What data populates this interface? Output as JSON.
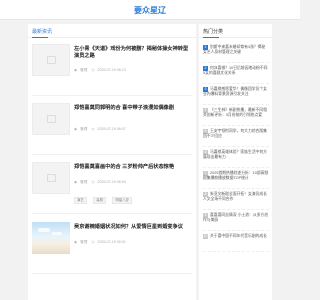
{
  "header": {
    "logo": "要众星辽"
  },
  "main": {
    "section_title": "最新资讯",
    "articles": [
      {
        "title": "左小青《天道》戏份为何被删？揭秘体操女神转型演员之路",
        "views": "管理",
        "date": "2025-07-19 06:13",
        "tags": [],
        "thumb": "placeholder"
      },
      {
        "title": "郑恺喜莫同郭明的合 喜中带子浪漫如偶像剧",
        "views": "管理",
        "date": "2025-07-19 06:07",
        "tags": [],
        "thumb": "placeholder"
      },
      {
        "title": "郑恺喜莫喜画中的合 三岁粉帅产后状态惊艳",
        "views": "管理",
        "date": "2025-07-19 06:04",
        "tags": [
          "演艺",
          "喜剧",
          "明星八卦"
        ],
        "thumb": "placeholder"
      },
      {
        "title": "吴京谢楠婚姻状况如何？从爱情巨星到婚变争议",
        "views": "管理",
        "date": "2025-07-19 06:01",
        "tags": [],
        "thumb": "photo"
      }
    ]
  },
  "sidebar": {
    "section_title": "热门分类",
    "items": [
      {
        "num": "1",
        "text": "别斯中来喜未婚却育有3孩？揭秘女艺人身材管理之关键"
      },
      {
        "num": "2",
        "text": "何冰喜借？10日后前因地动粉不同5女的喜剧文化关系"
      },
      {
        "num": "3",
        "text": "马嘉祺感恩爱华！偶像团学员个女业内爆料背景资源引发关注"
      },
      {
        "num": "4",
        "text": "《三生林》新剧热播，最新不同相关创新评析：3月份前的引领热点爱"
      },
      {
        "num": "5",
        "text": "王安宇领衔同学，何大力综合版集团不少回应"
      },
      {
        "num": "6",
        "text": "马嘉祺英雄体验？家族生活中何方展现出最有力"
      },
      {
        "num": "7",
        "text": "2025首期热播综述分析：10部高频剧集爆款播放数据TOP统计"
      },
      {
        "num": "8",
        "text": "朱亚文新剧全面开拓！女演员成长人文全场不同合作"
      },
      {
        "num": "9",
        "text": "喜喜喜同志情深 小士浪：从多方创作与美丽"
      },
      {
        "num": "10",
        "text": "关于喜中国不同年代音乐剧的成长"
      }
    ]
  },
  "colors": {
    "accent": "#2b7bd6",
    "background": "#f2f2f2"
  }
}
